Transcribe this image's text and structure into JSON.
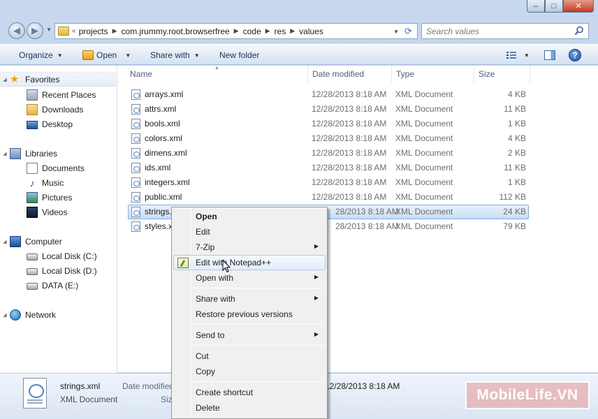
{
  "window": {
    "caption": {
      "minimize": "–",
      "maximize": "□",
      "close": "✕"
    }
  },
  "address": {
    "chevron": "«",
    "crumbs": [
      "projects",
      "com.jrummy.root.browserfree",
      "code",
      "res",
      "values"
    ],
    "search_placeholder": "Search values"
  },
  "toolbar": {
    "organize": "Organize",
    "open": "Open",
    "share_with": "Share with",
    "new_folder": "New folder"
  },
  "nav": {
    "favorites": "Favorites",
    "recent_places": "Recent Places",
    "downloads": "Downloads",
    "desktop": "Desktop",
    "libraries": "Libraries",
    "documents": "Documents",
    "music": "Music",
    "pictures": "Pictures",
    "videos": "Videos",
    "computer": "Computer",
    "local_c": "Local Disk (C:)",
    "local_d": "Local Disk (D:)",
    "data_e": "DATA (E:)",
    "network": "Network"
  },
  "columns": {
    "name": "Name",
    "date": "Date modified",
    "type": "Type",
    "size": "Size"
  },
  "files": [
    {
      "name": "arrays.xml",
      "date": "12/28/2013 8:18 AM",
      "type": "XML Document",
      "size": "4 KB"
    },
    {
      "name": "attrs.xml",
      "date": "12/28/2013 8:18 AM",
      "type": "XML Document",
      "size": "11 KB"
    },
    {
      "name": "bools.xml",
      "date": "12/28/2013 8:18 AM",
      "type": "XML Document",
      "size": "1 KB"
    },
    {
      "name": "colors.xml",
      "date": "12/28/2013 8:18 AM",
      "type": "XML Document",
      "size": "4 KB"
    },
    {
      "name": "dimens.xml",
      "date": "12/28/2013 8:18 AM",
      "type": "XML Document",
      "size": "2 KB"
    },
    {
      "name": "ids.xml",
      "date": "12/28/2013 8:18 AM",
      "type": "XML Document",
      "size": "11 KB"
    },
    {
      "name": "integers.xml",
      "date": "12/28/2013 8:18 AM",
      "type": "XML Document",
      "size": "1 KB"
    },
    {
      "name": "public.xml",
      "date": "12/28/2013 8:18 AM",
      "type": "XML Document",
      "size": "112 KB"
    },
    {
      "name": "strings.xml",
      "date": "28/2013 8:18 AM",
      "type": "XML Document",
      "size": "24 KB"
    },
    {
      "name": "styles.x",
      "date": "28/2013 8:18 AM",
      "type": "XML Document",
      "size": "79 KB"
    }
  ],
  "context_menu": {
    "open": "Open",
    "edit": "Edit",
    "seven_zip": "7-Zip",
    "edit_notepad": "Edit with Notepad++",
    "open_with": "Open with",
    "share_with": "Share with",
    "restore": "Restore previous versions",
    "send_to": "Send to",
    "cut": "Cut",
    "copy": "Copy",
    "create_shortcut": "Create shortcut",
    "delete": "Delete"
  },
  "details": {
    "name": "strings.xml",
    "type": "XML Document",
    "date_label": "Date modified",
    "size_label": "Siz",
    "date_value": "12/28/2013 8:18 AM"
  },
  "watermark": "MobileLife.VN"
}
